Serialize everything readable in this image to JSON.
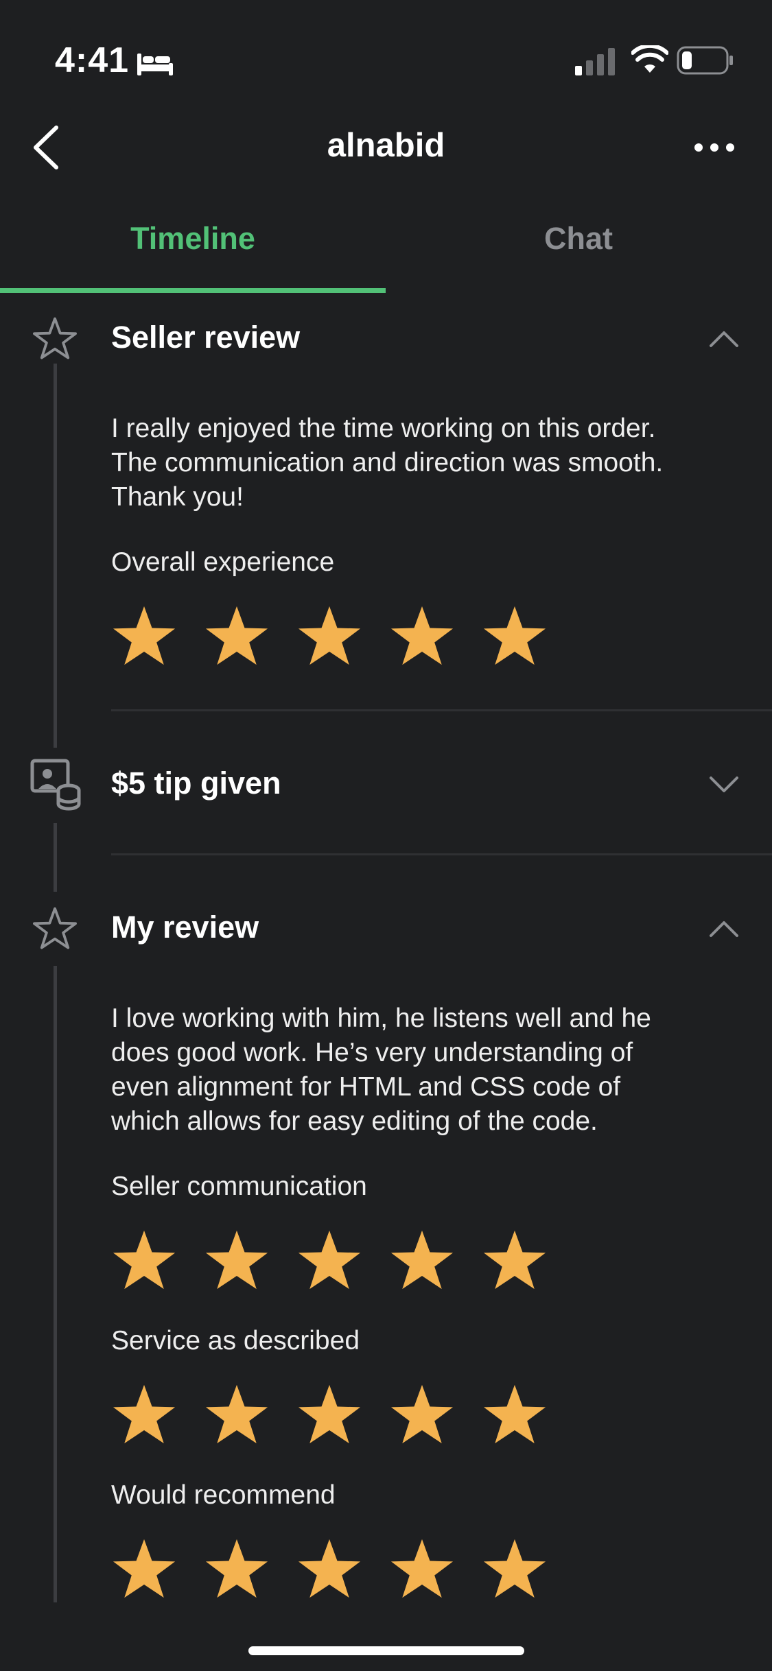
{
  "status_bar": {
    "time": "4:41"
  },
  "nav": {
    "title": "alnabid"
  },
  "tabs": [
    {
      "label": "Timeline",
      "active": true
    },
    {
      "label": "Chat",
      "active": false
    }
  ],
  "colors": {
    "accent": "#52c177",
    "star": "#f4b350",
    "background": "#1e1f21"
  },
  "timeline": {
    "seller_review": {
      "icon": "star-outline-icon",
      "title": "Seller review",
      "text_lines": [
        "I really enjoyed the time working on this order.",
        "The communication and direction was smooth.",
        "Thank you!"
      ],
      "rating_label": "Overall experience",
      "rating": 5
    },
    "tip": {
      "icon": "tip-coins-icon",
      "title": "$5 tip given"
    },
    "my_review": {
      "icon": "star-outline-icon",
      "title": "My review",
      "text_lines": [
        "I love working with him, he listens well and he",
        "does good work.  He’s very understanding of",
        "even alignment for HTML and CSS code of",
        "which allows for easy editing of the code."
      ],
      "ratings": [
        {
          "label": "Seller communication",
          "value": 5
        },
        {
          "label": "Service as described",
          "value": 5
        },
        {
          "label": "Would recommend",
          "value": 5
        }
      ]
    }
  }
}
